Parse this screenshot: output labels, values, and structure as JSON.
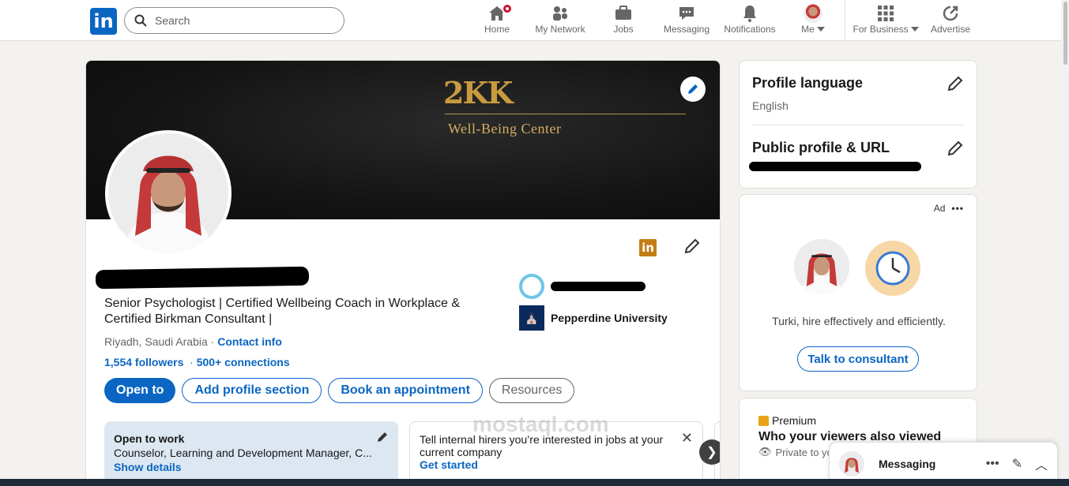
{
  "nav": {
    "search_placeholder": "Search",
    "items": [
      {
        "label": "Home"
      },
      {
        "label": "My Network"
      },
      {
        "label": "Jobs"
      },
      {
        "label": "Messaging"
      },
      {
        "label": "Notifications"
      },
      {
        "label": "Me"
      },
      {
        "label": "For Business"
      },
      {
        "label": "Advertise"
      }
    ]
  },
  "banner": {
    "brand": "2KK",
    "subtitle": "Well-Being Center"
  },
  "profile": {
    "headline": "Senior Psychologist | Certified Wellbeing Coach in Workplace & Certified Birkman Consultant |",
    "location": "Riyadh, Saudi Arabia",
    "contact_info": "Contact info",
    "followers": "1,554 followers",
    "connections": "500+ connections",
    "education": [
      {
        "name": ""
      },
      {
        "name": "Pepperdine University"
      }
    ],
    "buttons": {
      "open_to": "Open to",
      "add_section": "Add profile section",
      "book": "Book an appointment",
      "resources": "Resources"
    },
    "open_to_work": {
      "title": "Open to work",
      "detail": "Counselor, Learning and Development Manager, C...",
      "link": "Show details"
    },
    "hirers": {
      "text": "Tell internal hirers you’re interested in jobs at your current company",
      "link": "Get started"
    }
  },
  "sidebar": {
    "profile_language": {
      "title": "Profile language",
      "value": "English"
    },
    "public_profile": {
      "title": "Public profile & URL"
    },
    "ad": {
      "label": "Ad",
      "text": "Turki, hire effectively and efficiently.",
      "button": "Talk to consultant"
    },
    "premium": {
      "badge": "Premium",
      "title": "Who your viewers also viewed",
      "privacy": "Private to you"
    }
  },
  "messaging": {
    "title": "Messaging"
  },
  "watermark": "mostaql.com",
  "colors": {
    "accent": "#0a66c2",
    "brand_gold": "#c99b3e"
  }
}
